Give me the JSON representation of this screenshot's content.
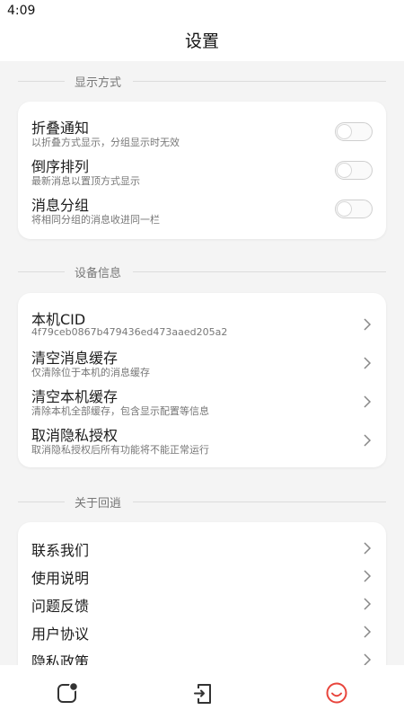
{
  "status_bar": {
    "time": "4:09"
  },
  "header": {
    "title": "设置"
  },
  "sections": {
    "display": {
      "title": "显示方式",
      "items": [
        {
          "title": "折叠通知",
          "subtitle": "以折叠方式显示，分组显示时无效",
          "toggle_on": false
        },
        {
          "title": "倒序排列",
          "subtitle": "最新消息以置顶方式显示",
          "toggle_on": false
        },
        {
          "title": "消息分组",
          "subtitle": "将相同分组的消息收进同一栏",
          "toggle_on": false
        }
      ]
    },
    "device": {
      "title": "设备信息",
      "items": [
        {
          "title": "本机CID",
          "subtitle": "4f79ceb0867b479436ed473aaed205a2"
        },
        {
          "title": "清空消息缓存",
          "subtitle": "仅清除位于本机的消息缓存"
        },
        {
          "title": "清空本机缓存",
          "subtitle": "清除本机全部缓存，包含显示配置等信息"
        },
        {
          "title": "取消隐私授权",
          "subtitle": "取消隐私授权后所有功能将不能正常运行"
        }
      ]
    },
    "about": {
      "title": "关于回逍",
      "items": [
        {
          "title": "联系我们"
        },
        {
          "title": "使用说明"
        },
        {
          "title": "问题反馈"
        },
        {
          "title": "用户协议"
        },
        {
          "title": "隐私政策"
        }
      ]
    }
  },
  "bottom_nav": {
    "items": [
      {
        "icon": "message-icon"
      },
      {
        "icon": "device-icon"
      },
      {
        "icon": "smiley-icon"
      }
    ],
    "active_color": "#e8453c",
    "inactive_color": "#333333"
  }
}
